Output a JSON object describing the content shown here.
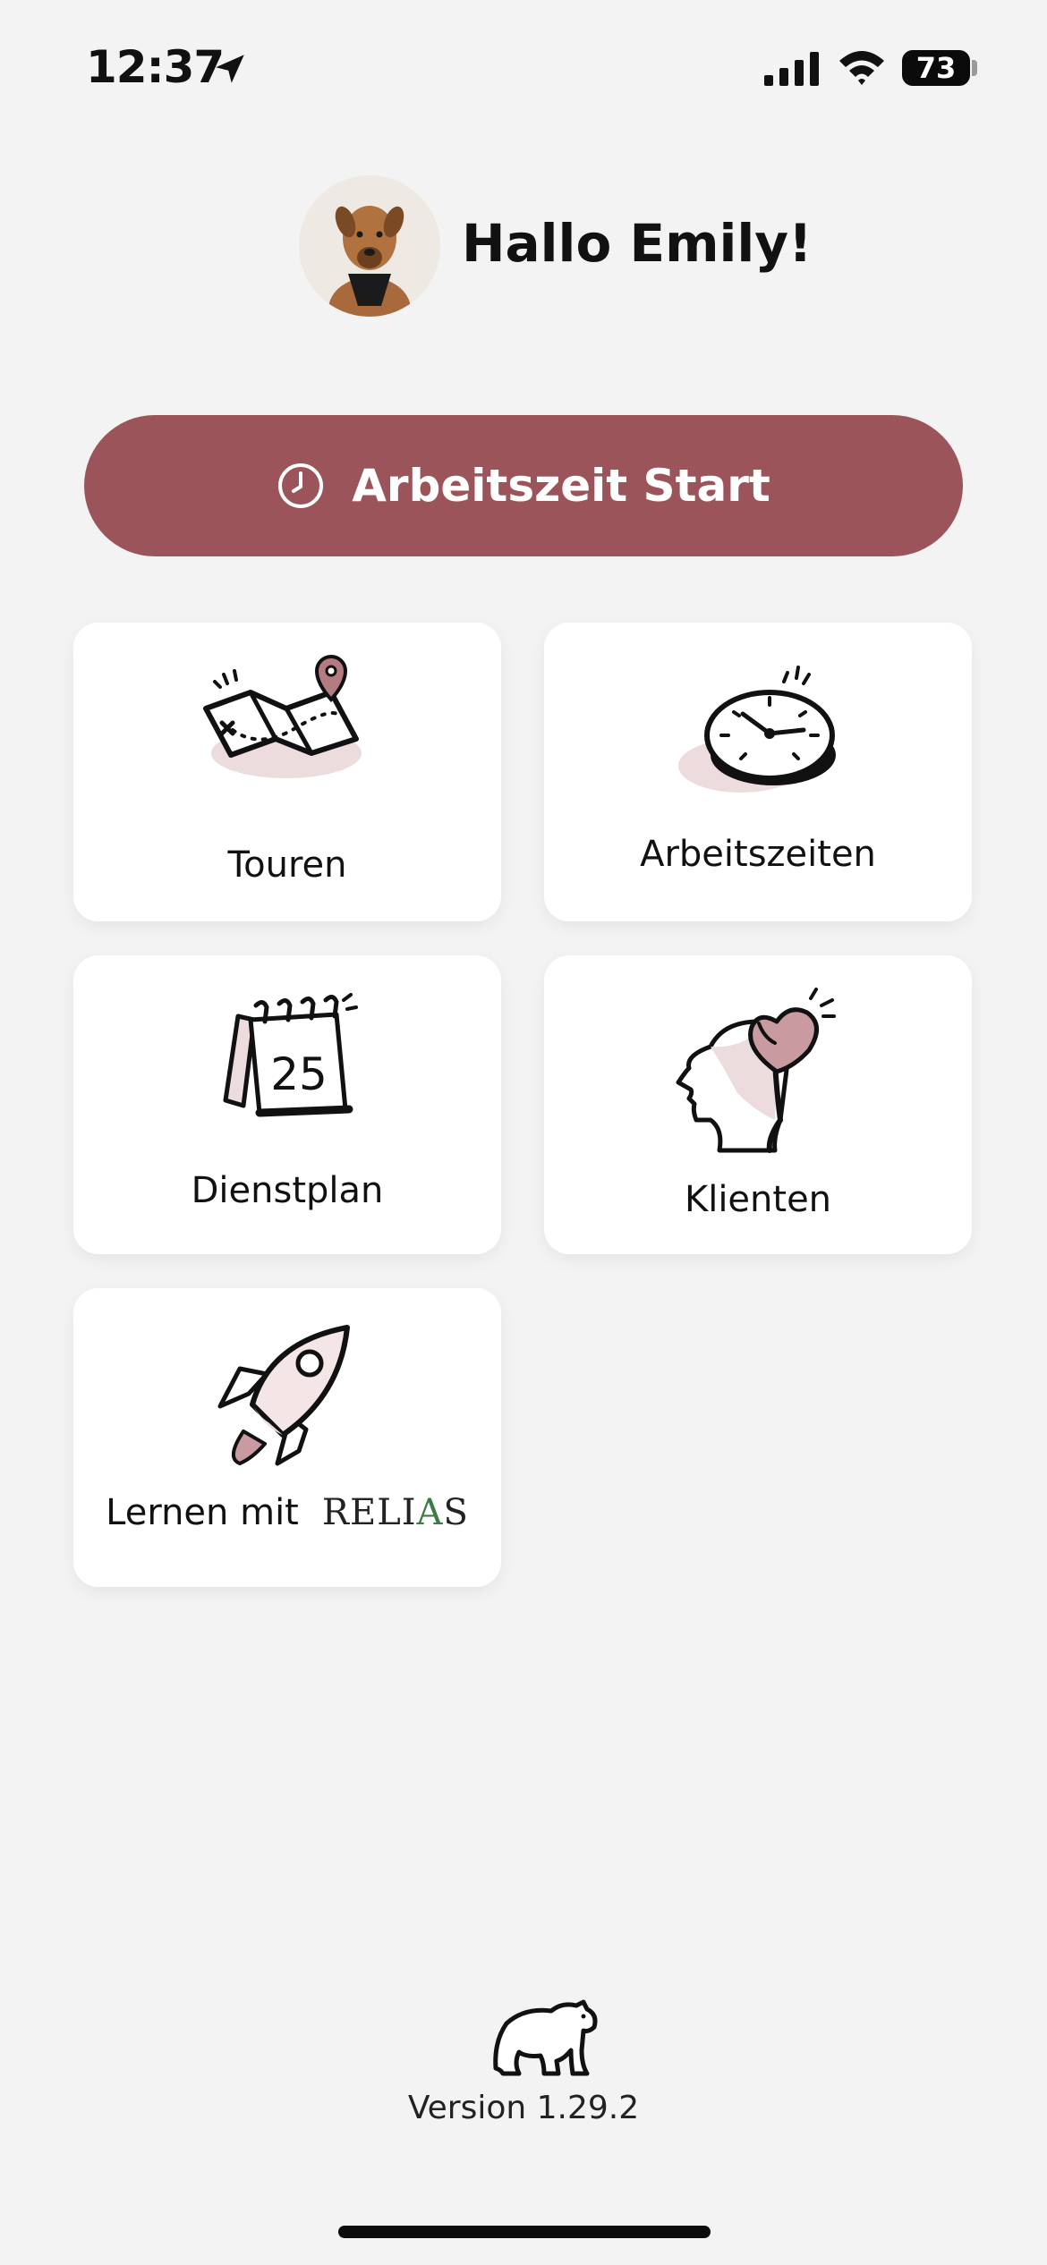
{
  "status_bar": {
    "time": "12:37",
    "battery": "73",
    "icons": [
      "location-arrow-icon",
      "cellular-signal-icon",
      "wifi-icon",
      "battery-icon"
    ]
  },
  "header": {
    "greeting": "Hallo Emily!"
  },
  "start_button": {
    "label": "Arbeitszeit Start",
    "icon": "clock-icon",
    "color": "#9b5459"
  },
  "tiles": [
    {
      "label": "Touren",
      "icon": "map-icon"
    },
    {
      "label": "Arbeitszeiten",
      "icon": "stopwatch-icon"
    },
    {
      "label": "Dienstplan",
      "icon": "calendar-icon",
      "calendar_number": "25"
    },
    {
      "label": "Klienten",
      "icon": "head-heart-icon"
    },
    {
      "label": "Lernen mit",
      "icon": "rocket-icon",
      "brand": "RELIAS"
    }
  ],
  "footer": {
    "logo": "bear-logo-icon",
    "version": "Version 1.29.2"
  },
  "colors": {
    "accent": "#9b5459",
    "background": "#f3f3f3",
    "tile": "#ffffff",
    "soft_pink": "#eddcde",
    "relias_green": "#3c7a46"
  }
}
